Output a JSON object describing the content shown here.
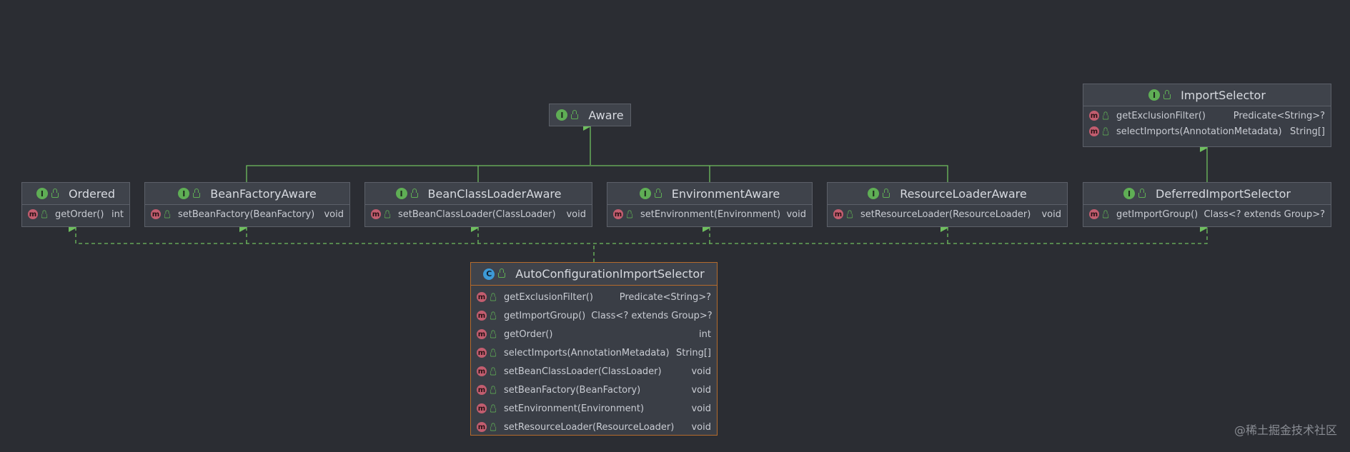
{
  "nodes": {
    "aware": {
      "title": "Aware",
      "kind": "I"
    },
    "import_selector": {
      "title": "ImportSelector",
      "kind": "I",
      "methods": [
        {
          "name": "getExclusionFilter()",
          "type": "Predicate<String>?"
        },
        {
          "name": "selectImports(AnnotationMetadata)",
          "type": "String[]"
        }
      ]
    },
    "ordered": {
      "title": "Ordered",
      "kind": "I",
      "methods": [
        {
          "name": "getOrder()",
          "type": "int"
        }
      ]
    },
    "bean_factory_aware": {
      "title": "BeanFactoryAware",
      "kind": "I",
      "methods": [
        {
          "name": "setBeanFactory(BeanFactory)",
          "type": "void"
        }
      ]
    },
    "bean_class_loader_aware": {
      "title": "BeanClassLoaderAware",
      "kind": "I",
      "methods": [
        {
          "name": "setBeanClassLoader(ClassLoader)",
          "type": "void"
        }
      ]
    },
    "environment_aware": {
      "title": "EnvironmentAware",
      "kind": "I",
      "methods": [
        {
          "name": "setEnvironment(Environment)",
          "type": "void"
        }
      ]
    },
    "resource_loader_aware": {
      "title": "ResourceLoaderAware",
      "kind": "I",
      "methods": [
        {
          "name": "setResourceLoader(ResourceLoader)",
          "type": "void"
        }
      ]
    },
    "deferred_import_selector": {
      "title": "DeferredImportSelector",
      "kind": "I",
      "methods": [
        {
          "name": "getImportGroup()",
          "type": "Class<? extends Group>?"
        }
      ]
    },
    "auto_config": {
      "title": "AutoConfigurationImportSelector",
      "kind": "C",
      "methods": [
        {
          "name": "getExclusionFilter()",
          "type": "Predicate<String>?"
        },
        {
          "name": "getImportGroup()",
          "type": "Class<? extends Group>?"
        },
        {
          "name": "getOrder()",
          "type": "int"
        },
        {
          "name": "selectImports(AnnotationMetadata)",
          "type": "String[]"
        },
        {
          "name": "setBeanClassLoader(ClassLoader)",
          "type": "void"
        },
        {
          "name": "setBeanFactory(BeanFactory)",
          "type": "void"
        },
        {
          "name": "setEnvironment(Environment)",
          "type": "void"
        },
        {
          "name": "setResourceLoader(ResourceLoader)",
          "type": "void"
        }
      ]
    }
  },
  "badges": {
    "interface": "I",
    "class": "C",
    "method": "m"
  },
  "colors": {
    "background": "#2b2d33",
    "extends_line": "#6fbf5f",
    "implements_line": "#6fbf5f",
    "class_border": "#b46b2d"
  },
  "watermark": "@稀土掘金技术社区"
}
